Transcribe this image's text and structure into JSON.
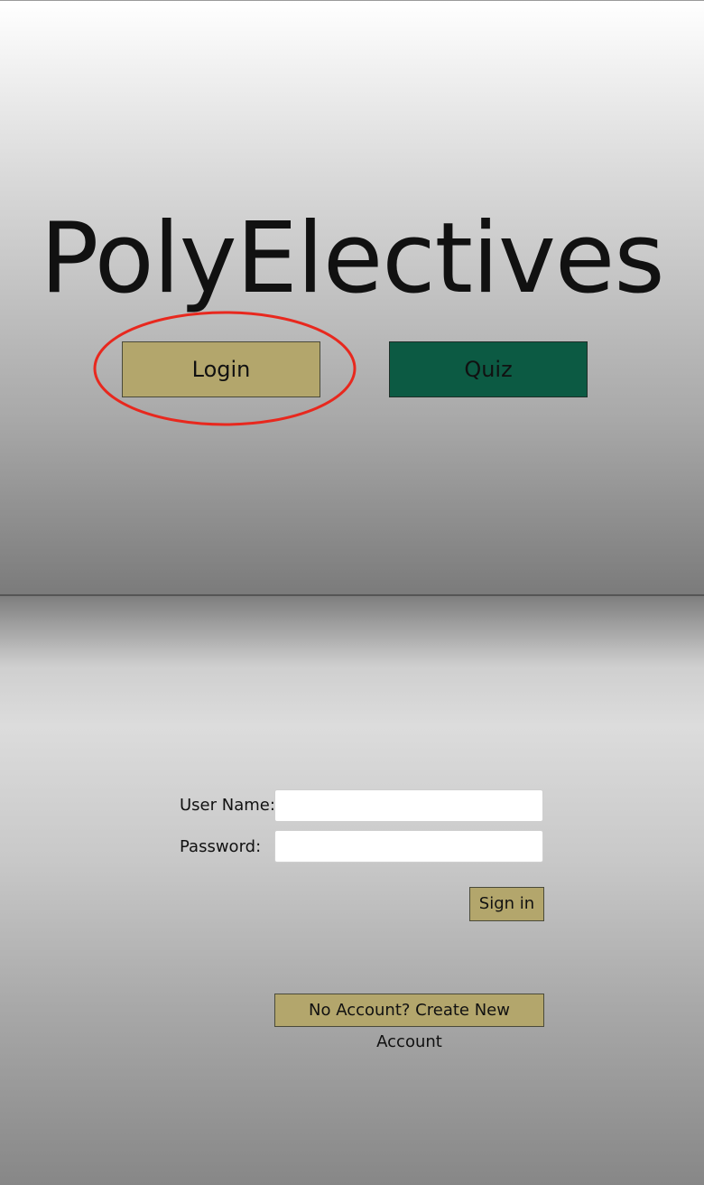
{
  "home": {
    "title": "PolyElectives",
    "login_label": "Login",
    "quiz_label": "Quiz",
    "highlight_color": "#e8281e",
    "login_color": "#b3a66c",
    "quiz_color": "#0c5a43"
  },
  "login_form": {
    "username_label": "User Name:",
    "username_value": "",
    "password_label": "Password:",
    "password_value": "",
    "signin_label": "Sign in",
    "create_account_label": "No Account? Create New Account"
  }
}
